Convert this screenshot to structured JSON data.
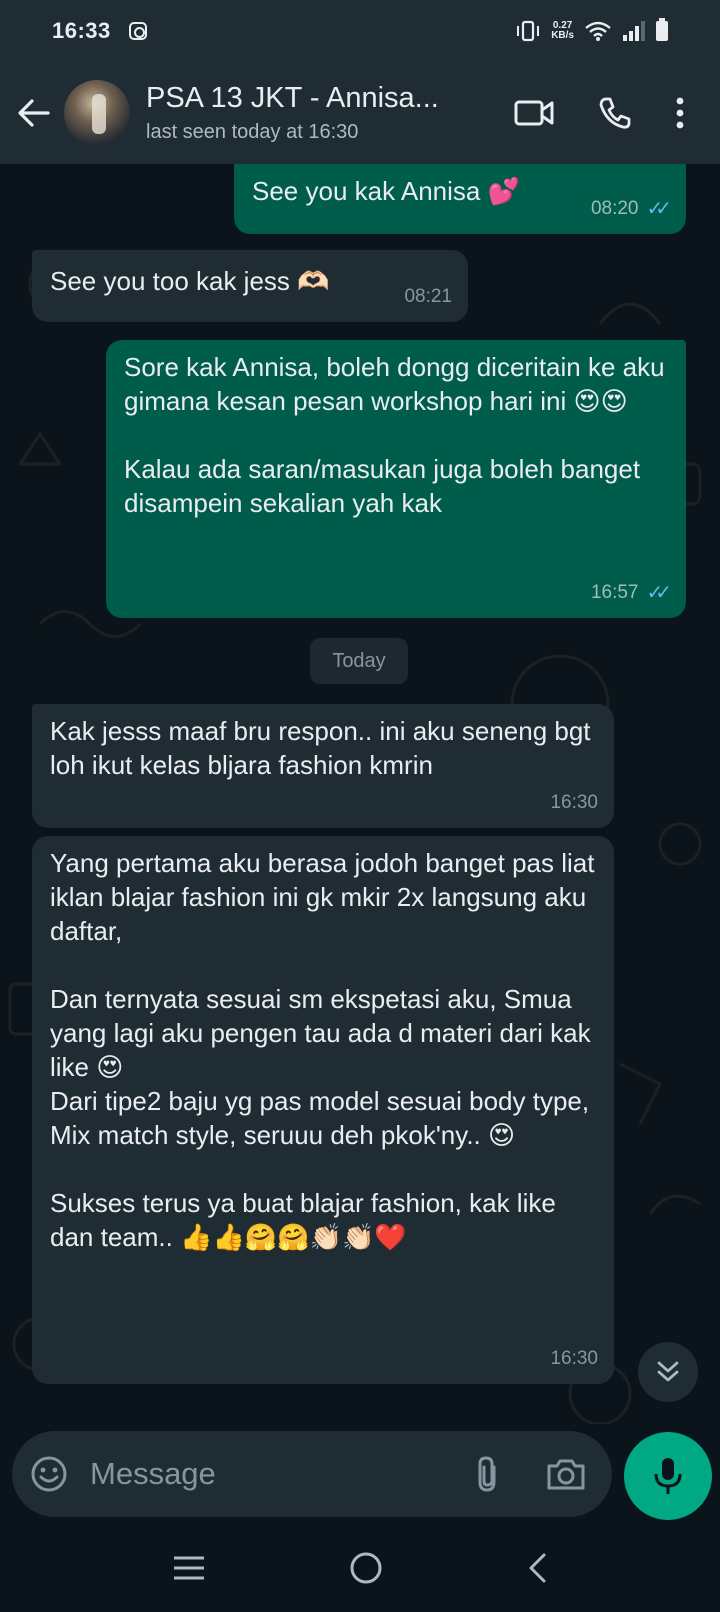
{
  "status_bar": {
    "time": "16:33",
    "net_speed": "0.27",
    "net_unit": "KB/s"
  },
  "header": {
    "contact_name": "PSA 13 JKT - Annisa...",
    "last_seen": "last seen today at 16:30"
  },
  "messages": [
    {
      "direction": "outgoing",
      "text": "See you kak Annisa 💕",
      "time": "08:20",
      "status": "read"
    },
    {
      "direction": "incoming",
      "text": "See you too kak jess 🫶🏻",
      "time": "08:21"
    },
    {
      "direction": "outgoing",
      "text": "Sore kak Annisa, boleh dongg diceritain ke aku gimana kesan pesan workshop hari ini 😍😍\n\nKalau ada saran/masukan juga boleh banget disampein sekalian yah kak",
      "time": "16:57",
      "status": "read"
    },
    {
      "direction": "incoming",
      "text": "Kak jesss maaf bru respon.. ini aku seneng bgt loh ikut kelas bljara fashion kmrin",
      "time": "16:30"
    },
    {
      "direction": "incoming",
      "text": "Yang pertama aku berasa jodoh banget pas liat iklan blajar fashion ini gk mkir 2x langsung aku daftar,\n\nDan ternyata sesuai sm ekspetasi aku, Smua yang lagi aku pengen tau ada d materi dari kak like 😍\nDari tipe2 baju yg pas model sesuai body type, Mix match style, seruuu deh pkok'ny.. 😍\n\nSukses terus ya buat blajar fashion, kak like dan team.. 👍👍🤗🤗👏🏻👏🏻❤️",
      "time": "16:30"
    }
  ],
  "day_divider": "Today",
  "composer": {
    "placeholder": "Message"
  },
  "colors": {
    "outgoing_bubble": "#005c4b",
    "incoming_bubble": "#202c33",
    "accent": "#00a884",
    "read_ticks": "#53bdeb"
  }
}
